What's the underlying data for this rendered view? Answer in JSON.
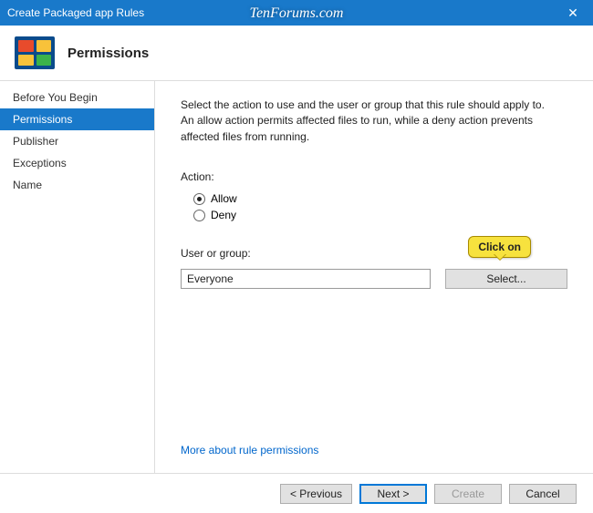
{
  "window": {
    "title": "Create Packaged app Rules",
    "close_glyph": "✕",
    "watermark": "TenForums.com"
  },
  "header": {
    "title": "Permissions"
  },
  "sidebar": {
    "items": [
      {
        "label": "Before You Begin",
        "active": false
      },
      {
        "label": "Permissions",
        "active": true
      },
      {
        "label": "Publisher",
        "active": false
      },
      {
        "label": "Exceptions",
        "active": false
      },
      {
        "label": "Name",
        "active": false
      }
    ]
  },
  "content": {
    "description": "Select the action to use and the user or group that this rule should apply to. An allow action permits affected files to run, while a deny action prevents affected files from running.",
    "action_label": "Action:",
    "radios": {
      "allow": "Allow",
      "deny": "Deny",
      "selected": "allow"
    },
    "user_group_label": "User or group:",
    "user_group_value": "Everyone",
    "select_button": "Select...",
    "callout": "Click on",
    "more_link": "More about rule permissions"
  },
  "footer": {
    "previous": "< Previous",
    "next": "Next >",
    "create": "Create",
    "cancel": "Cancel"
  }
}
